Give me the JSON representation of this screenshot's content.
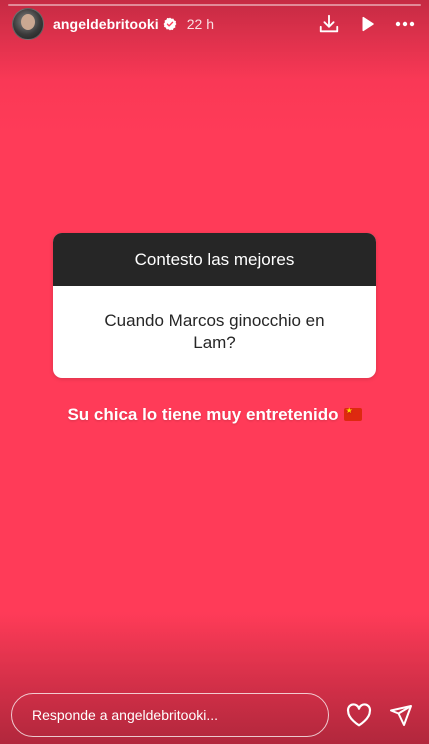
{
  "header": {
    "username": "angeldebritooki",
    "time": "22 h",
    "icons": [
      "verified-badge-icon",
      "download-icon",
      "play-icon",
      "more-icon"
    ]
  },
  "question_card": {
    "title": "Contesto las mejores",
    "question": "Cuando Marcos ginocchio en Lam?"
  },
  "caption": {
    "text": "Su chica lo tiene muy entretenido",
    "emoji_icon": "china-flag-icon"
  },
  "footer": {
    "reply_placeholder": "Responde a angeldebritooki...",
    "icons": [
      "heart-icon",
      "send-icon"
    ]
  },
  "colors": {
    "background": "#ff3b58",
    "card_header": "#262626",
    "card_body": "#ffffff",
    "text_on_background": "#ffffff"
  }
}
